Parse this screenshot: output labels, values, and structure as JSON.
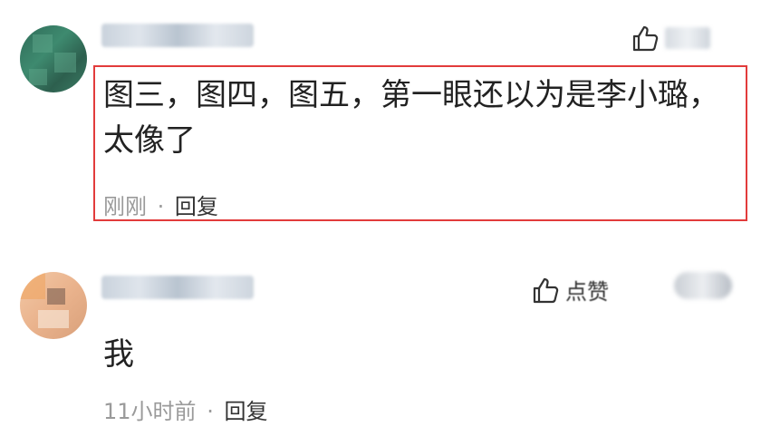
{
  "comments": [
    {
      "text": "图三，图四，图五，第一眼还以为是李小璐，太像了",
      "time": "刚刚",
      "separator": "·",
      "reply_label": "回复",
      "like_label": "点赞",
      "highlighted": true
    },
    {
      "text": "我",
      "time": "11小时前",
      "separator": "·",
      "reply_label": "回复",
      "like_label": "点赞",
      "highlighted": false
    }
  ],
  "icons": {
    "like": "thumbs-up-icon"
  },
  "colors": {
    "highlight_border": "#e23b3b",
    "meta_text": "#9a9a9a",
    "body_text": "#222222"
  }
}
